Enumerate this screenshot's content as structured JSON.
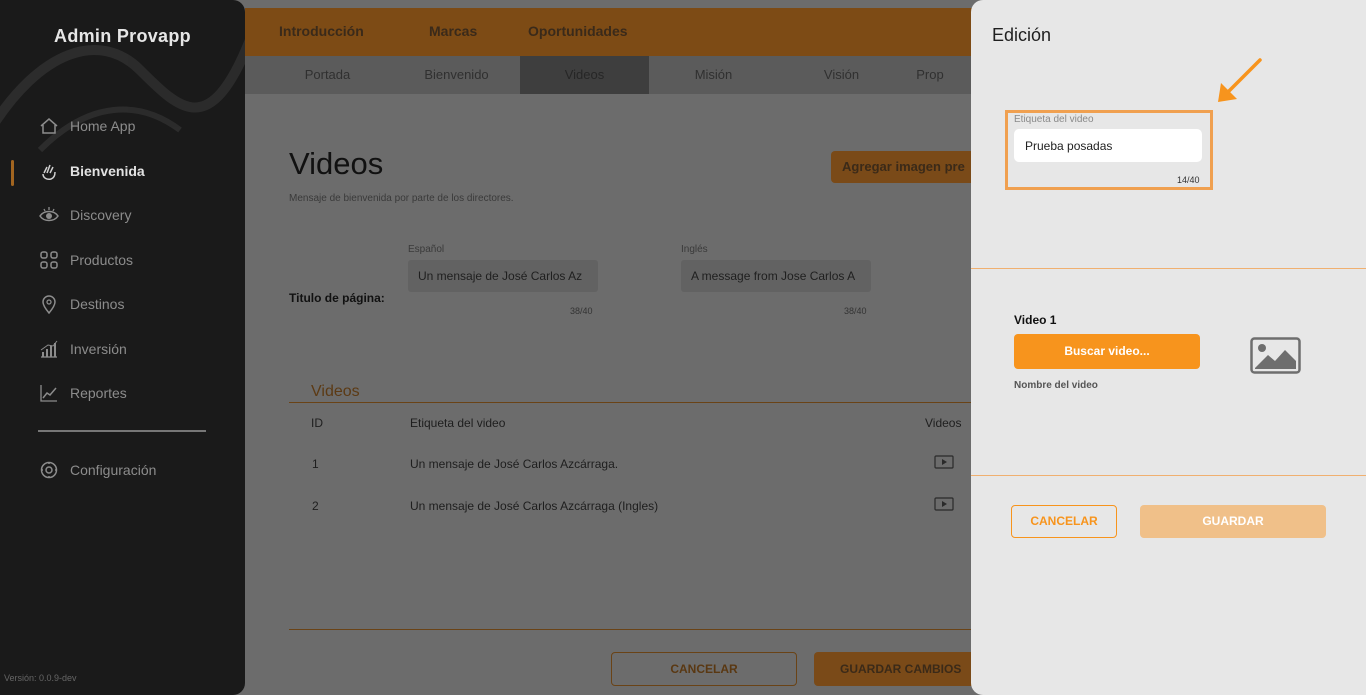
{
  "sidebar": {
    "app_title": "Admin Provapp",
    "items": [
      {
        "label": "Home App",
        "icon": "home-icon"
      },
      {
        "label": "Bienvenida",
        "icon": "waving-hand-icon",
        "active": true
      },
      {
        "label": "Discovery",
        "icon": "eye-icon"
      },
      {
        "label": "Productos",
        "icon": "grid-icon"
      },
      {
        "label": "Destinos",
        "icon": "location-pin-icon"
      },
      {
        "label": "Inversión",
        "icon": "bar-chart-icon"
      },
      {
        "label": "Reportes",
        "icon": "line-chart-icon"
      },
      {
        "label": "Configuración",
        "icon": "gear-icon"
      }
    ],
    "version": "Versión: 0.0.9-dev"
  },
  "top_tabs": [
    "Introducción",
    "Marcas",
    "Oportunidades"
  ],
  "sub_tabs": [
    "Portada",
    "Bienvenido",
    "Videos",
    "Misión",
    "Visión",
    "Prop"
  ],
  "sub_tabs_active": "Videos",
  "main": {
    "title": "Videos",
    "subtitle": "Mensaje de bienvenida por parte de los directores.",
    "add_image_button": "Agregar imagen pre",
    "row_label": "Titulo de página:",
    "spanish": {
      "label": "Español",
      "value": "Un mensaje de José Carlos Az",
      "count": "38/40"
    },
    "english": {
      "label": "Inglés",
      "value": "A message from Jose Carlos A",
      "count": "38/40"
    },
    "videos_section_title": "Videos",
    "table": {
      "headers": [
        "ID",
        "Etiqueta del video",
        "Videos"
      ],
      "rows": [
        {
          "id": "1",
          "label": "Un mensaje de José Carlos Azcárraga."
        },
        {
          "id": "2",
          "label": "Un mensaje de José Carlos Azcárraga (Ingles)"
        }
      ]
    },
    "cancel_button": "CANCELAR",
    "save_button": "GUARDAR CAMBIOS"
  },
  "panel": {
    "title": "Edición",
    "field_label": "Etiqueta del video",
    "field_value": "Prueba posadas",
    "field_count": "14/40",
    "video_label": "Video 1",
    "browse_button": "Buscar video...",
    "video_name_label": "Nombre del video",
    "cancel_button": "CANCELAR",
    "save_button": "GUARDAR"
  },
  "colors": {
    "accent": "#f7941d",
    "accent_disabled": "#f0c089",
    "highlight": "#f0a050",
    "sidebar_bg": "#1a1a1a",
    "panel_bg": "#e7e7e7"
  }
}
